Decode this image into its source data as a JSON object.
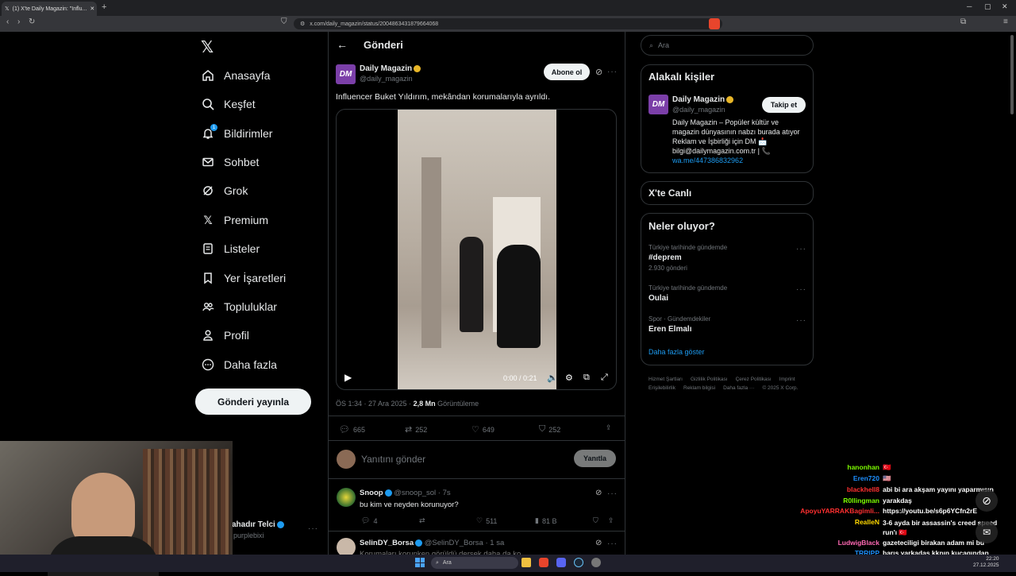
{
  "browser": {
    "tab_title": "(1) X'te Daily Magazin: \"Influ...",
    "url": "x.com/daily_magazin/status/2004863431879664068"
  },
  "nav": {
    "items": [
      {
        "label": "Anasayfa",
        "icon": "home-icon"
      },
      {
        "label": "Keşfet",
        "icon": "search-icon"
      },
      {
        "label": "Bildirimler",
        "icon": "bell-icon",
        "badge": "1"
      },
      {
        "label": "Sohbet",
        "icon": "mail-icon"
      },
      {
        "label": "Grok",
        "icon": "grok-icon"
      },
      {
        "label": "Premium",
        "icon": "x-logo-icon"
      },
      {
        "label": "Listeler",
        "icon": "list-icon"
      },
      {
        "label": "Yer İşaretleri",
        "icon": "bookmark-icon"
      },
      {
        "label": "Topluluklar",
        "icon": "people-icon"
      },
      {
        "label": "Profil",
        "icon": "person-icon"
      },
      {
        "label": "Daha fazla",
        "icon": "more-circle-icon"
      }
    ],
    "post_button": "Gönderi yayınla",
    "account_name": "ahadır Telci",
    "account_handle": "purplebixi"
  },
  "post": {
    "header_title": "Gönderi",
    "author_name": "Daily Magazin",
    "author_handle": "@daily_magazin",
    "avatar_text": "DM",
    "subscribe_label": "Abone ol",
    "text": "Influencer Buket Yıldırım, mekândan korumalarıyla ayrıldı.",
    "video_time": "0:00 / 0:21",
    "meta_time": "ÖS 1:34 · 27 Ara 2025 · ",
    "views": "2,8 Mn",
    "views_label": " Görüntüleme",
    "replies": "665",
    "reposts": "252",
    "likes": "649",
    "bookmarks": "252",
    "reply_placeholder": "Yanıtını gönder",
    "reply_button": "Yanıtla"
  },
  "replies": [
    {
      "name": "Snoop",
      "handle": "@snoop_sol · 7s",
      "text": "bu kim ve neyden korunuyor?",
      "replies": "4",
      "likes": "511",
      "views": "81 B"
    },
    {
      "name": "SelinDY_Borsa",
      "handle": "@SelinDY_Borsa · 1 sa",
      "text": "Korumaları korunken görüldü dersek daha da ko..."
    }
  ],
  "right": {
    "search_placeholder": "Ara",
    "related_title": "Alakalı kişiler",
    "related_name": "Daily Magazin",
    "related_handle": "@daily_magazin",
    "follow_label": "Takip et",
    "related_bio": "Daily Magazin – Popüler kültür ve magazin dünyasının nabzı burada atıyor Reklam ve İşbirliği için DM 📩 bilgi@dailymagazin.com.tr | 📞",
    "related_link": "wa.me/447386832962",
    "live_title": "X'te Canlı",
    "trends_title": "Neler oluyor?",
    "trends": [
      {
        "meta": "Türkiye tarihinde gündemde",
        "name": "#deprem",
        "count": "2.930 gönderi"
      },
      {
        "meta": "Türkiye tarihinde gündemde",
        "name": "Oulai",
        "count": ""
      },
      {
        "meta": "Spor · Gündemdekiler",
        "name": "Eren Elmalı",
        "count": ""
      }
    ],
    "show_more": "Daha fazla göster",
    "footer": [
      "Hizmet Şartları",
      "Gizlilik Politikası",
      "Çerez Politikası",
      "Imprint",
      "Erişilebilirlik",
      "Reklam bilgisi",
      "Daha fazla ···",
      "© 2025 X Corp."
    ]
  },
  "chat": [
    {
      "user": "hanonhan",
      "color": "#7CFC00",
      "msg": "🇹🇷"
    },
    {
      "user": "Eren720",
      "color": "#1E90FF",
      "msg": "🇺🇸"
    },
    {
      "user": "blackhell8",
      "color": "#FF3030",
      "msg": "abi bi ara akşam yayını yaparmısın"
    },
    {
      "user": "R0llingman",
      "color": "#7CFC00",
      "msg": "yarakdaş"
    },
    {
      "user": "ApoyuYARRAKBagimli...",
      "color": "#FF3030",
      "msg": "https://youtu.be/s6p6YCfn2rE"
    },
    {
      "user": "RealleN",
      "color": "#FFD700",
      "msg": "3-6 ayda bir assassin's creed speed run'ı 🇹🇷"
    },
    {
      "user": "LudwigBlack",
      "color": "#FF69B4",
      "msg": "gazeteciligi birakan adam mi bu"
    },
    {
      "user": "TRRIPP",
      "color": "#1E90FF",
      "msg": "barış yarkadaş kknın kucagından kalkıp programa'mı gelmiş"
    }
  ],
  "taskbar": {
    "search": "Ara",
    "time": "22:20",
    "date": "27.12.2025"
  }
}
